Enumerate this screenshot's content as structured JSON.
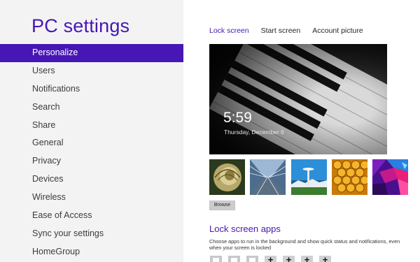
{
  "app": {
    "title": "PC settings"
  },
  "nav": {
    "items": [
      {
        "label": "Personalize",
        "selected": true
      },
      {
        "label": "Users"
      },
      {
        "label": "Notifications"
      },
      {
        "label": "Search"
      },
      {
        "label": "Share"
      },
      {
        "label": "General"
      },
      {
        "label": "Privacy"
      },
      {
        "label": "Devices"
      },
      {
        "label": "Wireless"
      },
      {
        "label": "Ease of Access"
      },
      {
        "label": "Sync your settings"
      },
      {
        "label": "HomeGroup"
      }
    ]
  },
  "tabs": [
    {
      "label": "Lock screen",
      "active": true
    },
    {
      "label": "Start screen"
    },
    {
      "label": "Account picture"
    }
  ],
  "lock_preview": {
    "time": "5:59",
    "date": "Thursday, December 6"
  },
  "thumbnails": [
    {
      "name": "nautilus-shell"
    },
    {
      "name": "highway-tunnel"
    },
    {
      "name": "space-needle"
    },
    {
      "name": "honeycomb"
    },
    {
      "name": "color-geometry"
    }
  ],
  "browse": {
    "label": "Browse"
  },
  "lock_screen_apps": {
    "heading": "Lock screen apps",
    "description": "Choose apps to run in the background and show quick status and notifications, even when your screen is locked"
  },
  "colors": {
    "accent": "#4617b4",
    "left_pane": "#f3f3f3"
  }
}
